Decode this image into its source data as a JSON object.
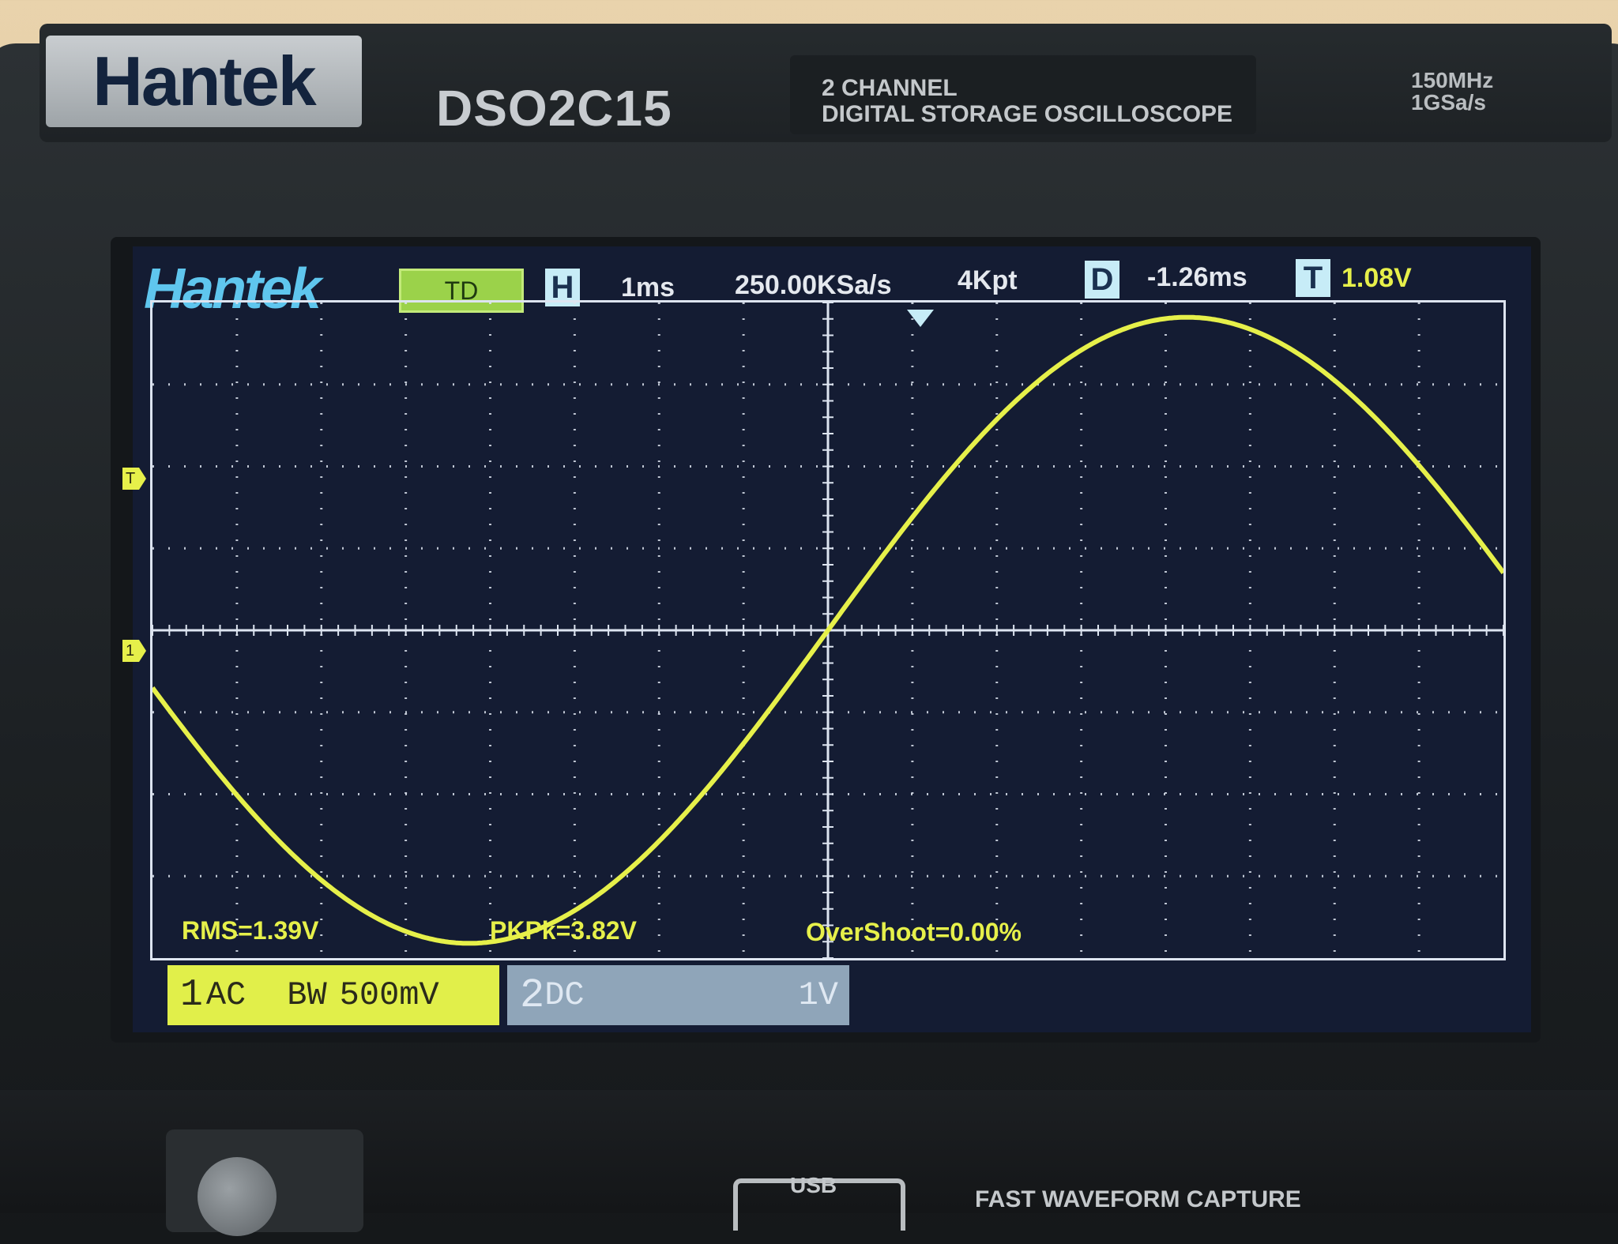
{
  "device": {
    "brand": "Hantek",
    "model": "DSO2C15",
    "description_line1": "2 CHANNEL",
    "description_line2": "DIGITAL STORAGE OSCILLOSCOPE",
    "spec_bandwidth": "150MHz",
    "spec_sample_rate": "1GSa/s",
    "usb_label": "USB",
    "fast_capture_label": "FAST WAVEFORM CAPTURE"
  },
  "screen": {
    "logo": "Hantek",
    "mode_label": "TD",
    "horizontal_label": "H",
    "timebase": "1ms",
    "sample_rate": "250.00KSa/s",
    "memory_depth": "4Kpt",
    "delay_label": "D",
    "delay_value": "-1.26ms",
    "trigger_label": "T",
    "trigger_level": "1.08V",
    "trigger_marker": "T",
    "ch1_marker": "1",
    "measurements": {
      "rms": "RMS=1.39V",
      "pkpk": "PKPk=3.82V",
      "overshoot": "OverShoot=0.00%"
    },
    "channel1": {
      "number": "1",
      "coupling": "AC",
      "bw": "BW",
      "scale": "500mV"
    },
    "channel2": {
      "number": "2",
      "coupling": "DC",
      "scale": "1V"
    }
  },
  "colors": {
    "trace": "#e6f04a",
    "screen_bg": "#141c33",
    "grid": "#dde4f0",
    "logo": "#5fc6ee",
    "td_badge": "#9bd24a",
    "ch2_bar": "#8fa5b9"
  }
}
